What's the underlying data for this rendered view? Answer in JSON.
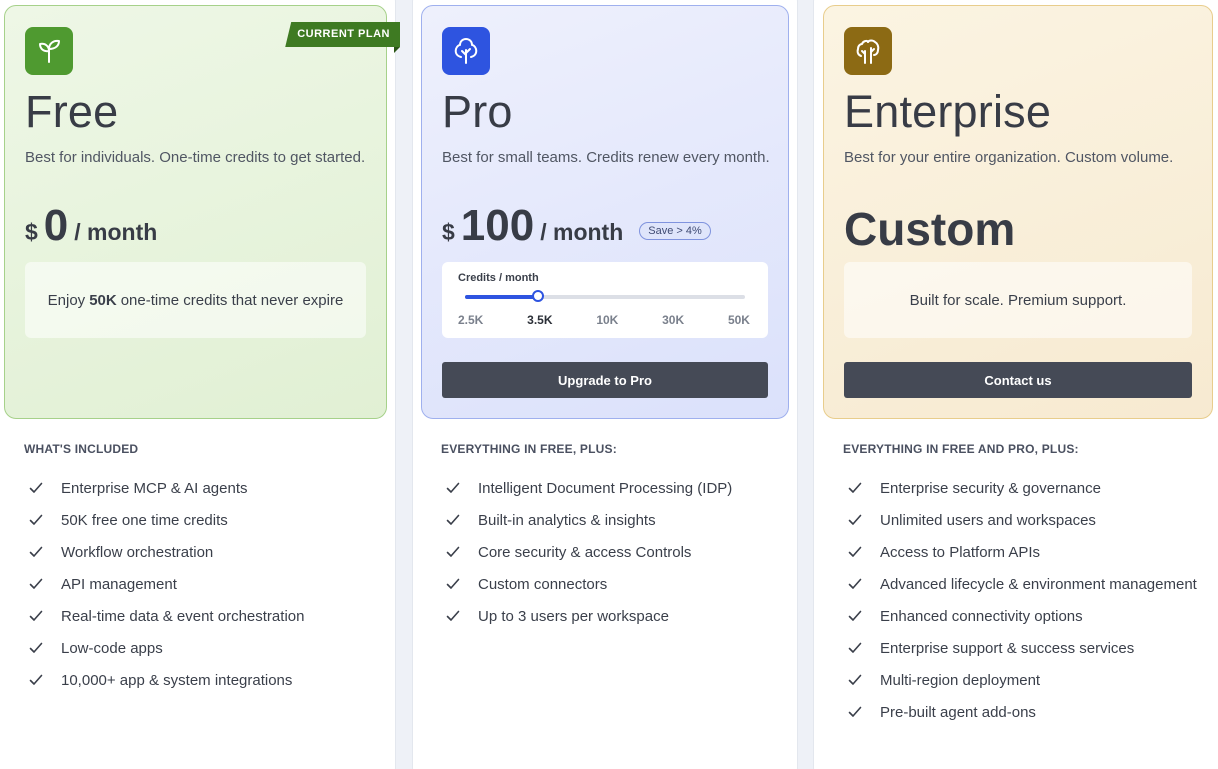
{
  "plans": [
    {
      "name": "Free",
      "badge": "CURRENT PLAN",
      "logo_icon": "sprout-icon",
      "description": "Best for individuals. One-time credits to get started.",
      "price": {
        "currency": "$",
        "amount": "0",
        "period": "/ month"
      },
      "info_bold": "50K",
      "info_text": "one-time credits that never expire",
      "info_prefix": "Enjoy",
      "section_title": "WHAT'S INCLUDED",
      "features": [
        "Enterprise MCP & AI agents",
        "50K free one time credits",
        "Workflow orchestration",
        "API management",
        "Real-time data & event orchestration",
        "Low-code apps",
        "10,000+ app & system integrations"
      ]
    },
    {
      "name": "Pro",
      "logo_icon": "tree-icon",
      "description": "Best for small teams. Credits renew every month.",
      "price": {
        "currency": "$",
        "amount": "100",
        "period": "/ month"
      },
      "save_badge": "Save > 4%",
      "slider": {
        "title": "Credits / month",
        "ticks": [
          "2.5K",
          "3.5K",
          "10K",
          "30K",
          "50K"
        ],
        "selected": "3.5K",
        "position_fraction": 0.26
      },
      "cta": "Upgrade to Pro",
      "section_title": "EVERYTHING IN FREE, PLUS:",
      "features": [
        "Intelligent Document Processing (IDP)",
        "Built-in analytics & insights",
        "Core security & access Controls",
        "Custom connectors",
        "Up to 3 users per workspace"
      ]
    },
    {
      "name": "Enterprise",
      "logo_icon": "forest-icon",
      "description": "Best for your entire organization. Custom volume.",
      "price_text": "Custom",
      "info_text": "Built for scale. Premium support.",
      "cta": "Contact us",
      "section_title": "EVERYTHING IN FREE AND PRO, PLUS:",
      "features": [
        "Enterprise security & governance",
        "Unlimited users and workspaces",
        "Access to Platform APIs",
        "Advanced lifecycle & environment management",
        "Enhanced connectivity options",
        "Enterprise support & success services",
        "Multi-region deployment",
        "Pre-built agent add-ons"
      ]
    }
  ],
  "colors": {
    "free_accent": "#4f9a30",
    "pro_accent": "#2e54e0",
    "enterprise_accent": "#8c6a14",
    "button": "#454a56"
  }
}
